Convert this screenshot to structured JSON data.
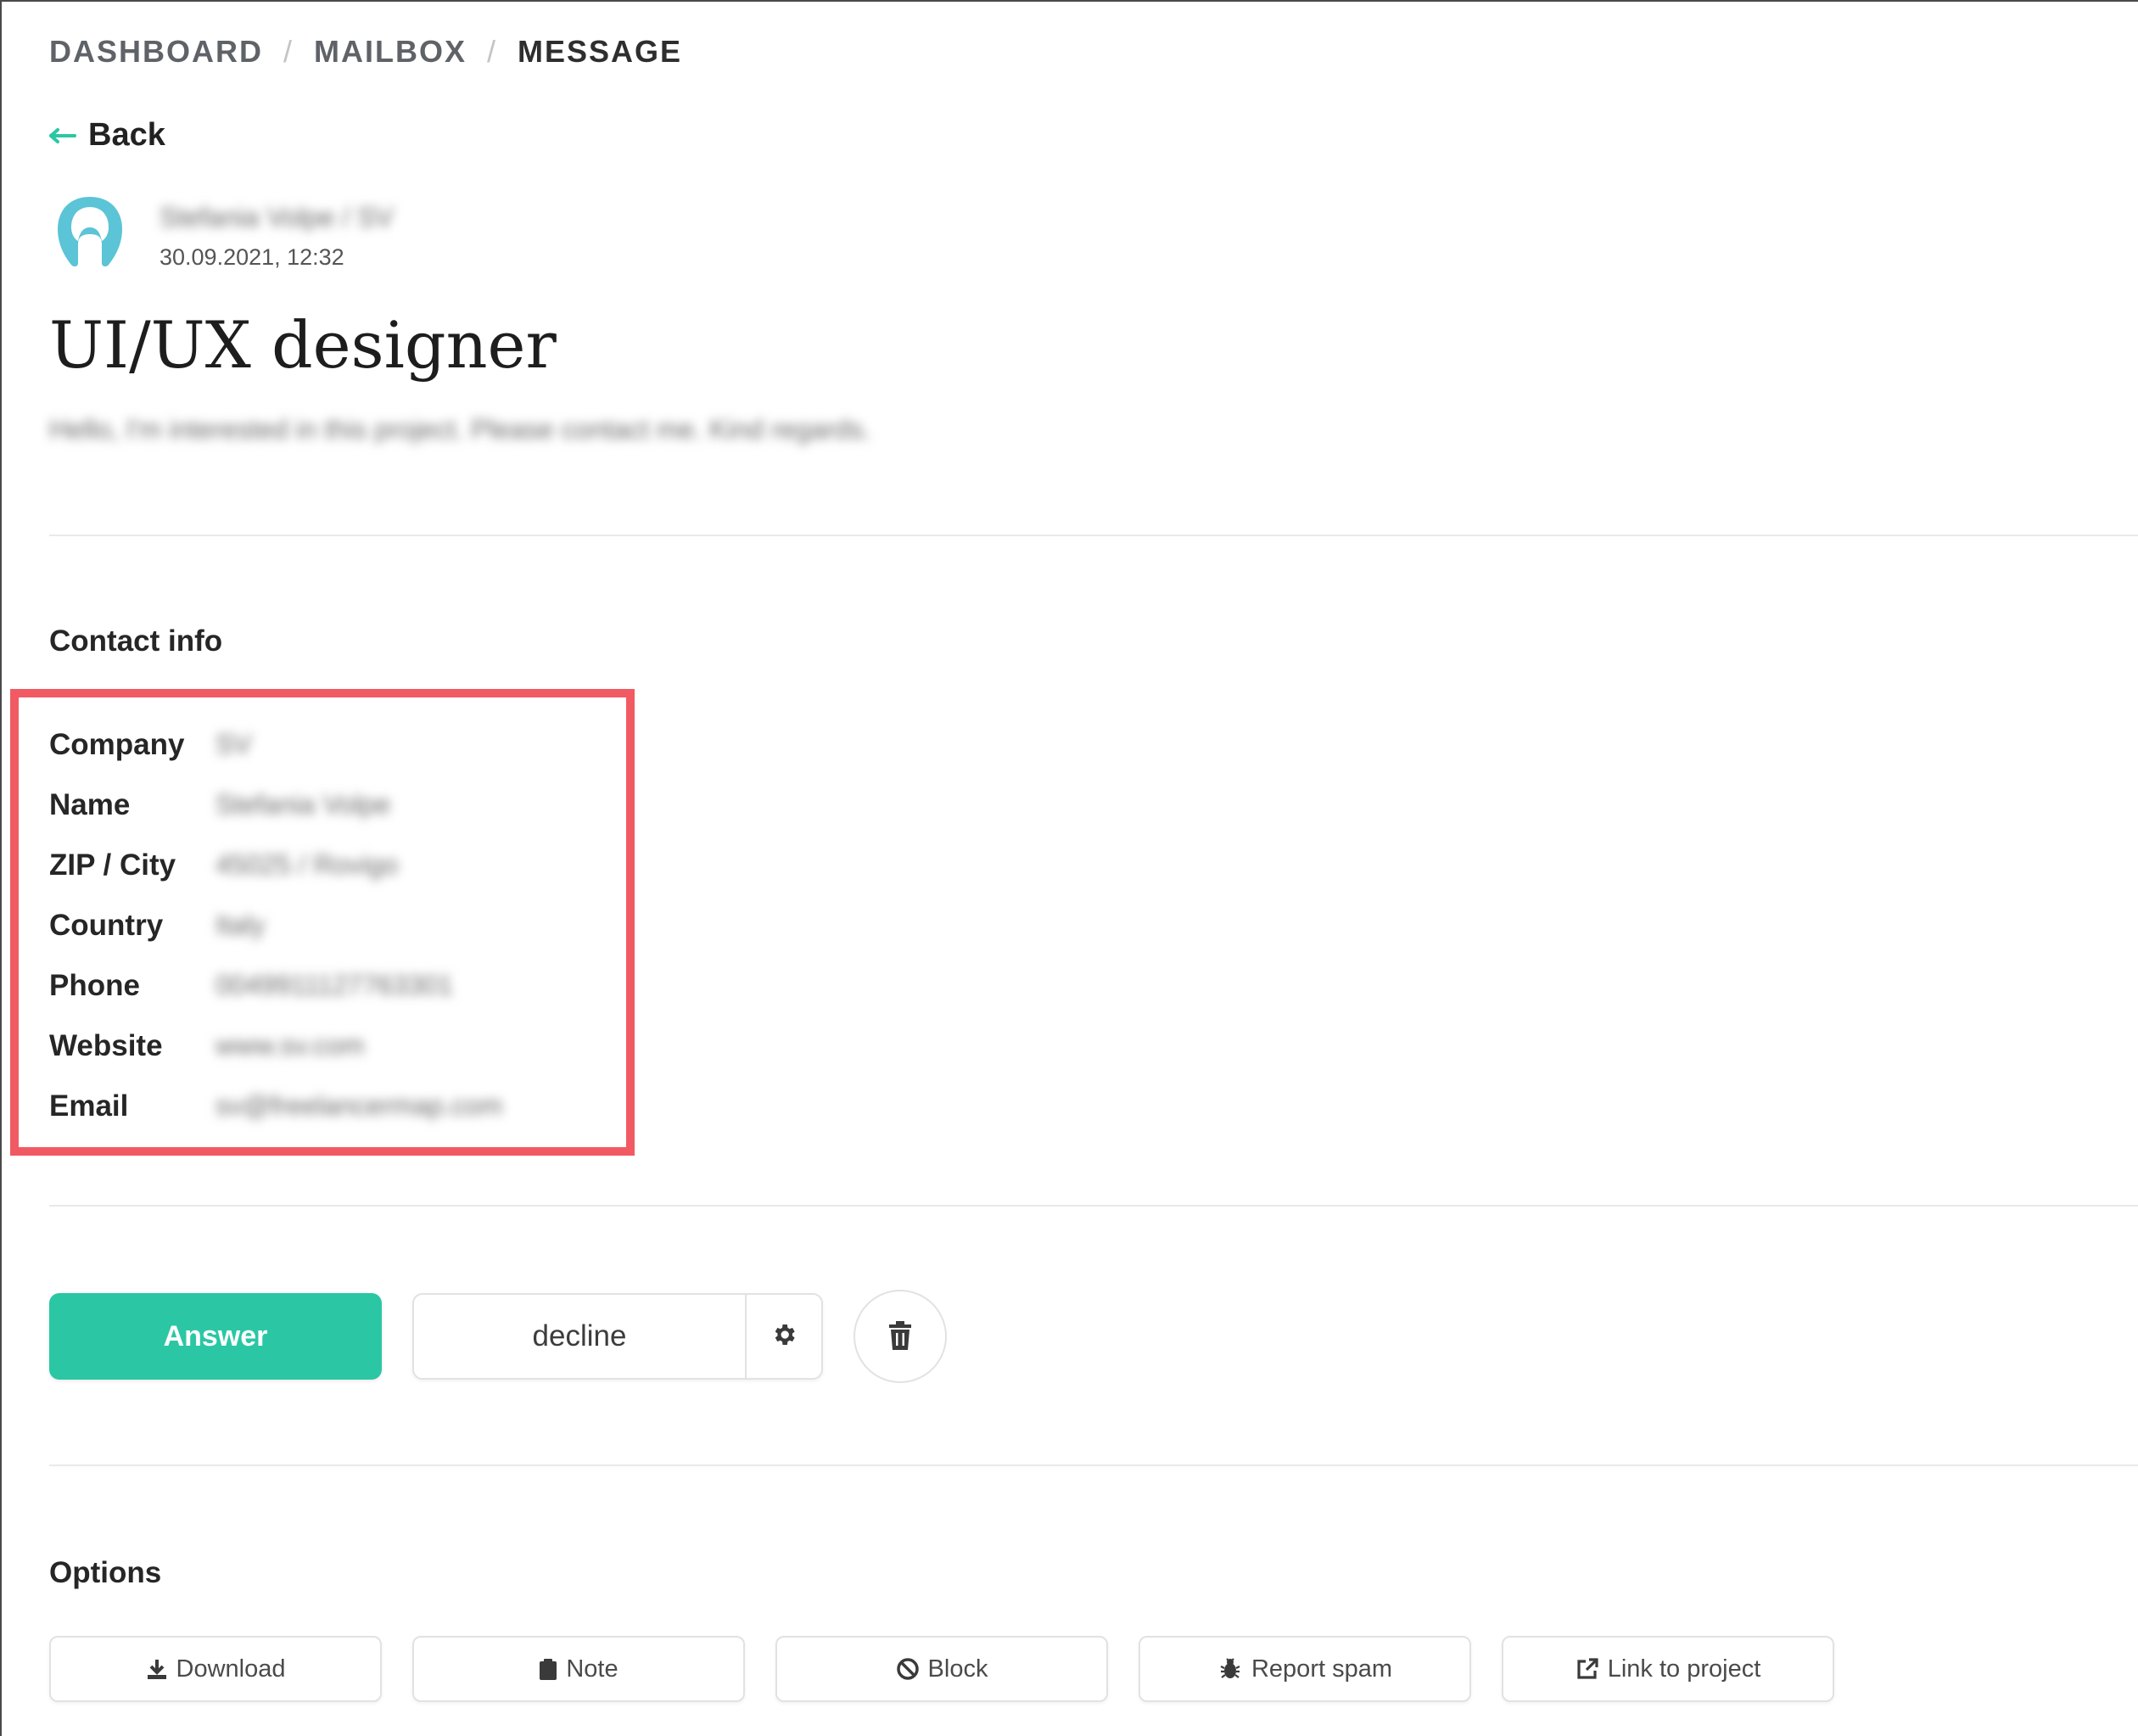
{
  "breadcrumb": {
    "items": [
      "DASHBOARD",
      "MAILBOX",
      "MESSAGE"
    ],
    "separator": "/"
  },
  "back": {
    "label": "Back",
    "icon": "arrow-left-icon"
  },
  "sender": {
    "name": "Stefania Volpe / SV",
    "date": "30.09.2021, 12:32",
    "avatar_icon": "user-avatar-icon"
  },
  "message": {
    "subject": "UI/UX designer",
    "body": "Hello, I'm interested in this project. Please contact me. Kind regards."
  },
  "contact": {
    "title": "Contact info",
    "rows": [
      {
        "label": "Company",
        "value": "SV"
      },
      {
        "label": "Name",
        "value": "Stefania Volpe"
      },
      {
        "label": "ZIP / City",
        "value": "45025 / Rovigo"
      },
      {
        "label": "Country",
        "value": "Italy"
      },
      {
        "label": "Phone",
        "value": "0049911127763301"
      },
      {
        "label": "Website",
        "value": "www.sv.com"
      },
      {
        "label": "Email",
        "value": "sv@freelancermap.com"
      }
    ]
  },
  "actions": {
    "answer": "Answer",
    "decline": "decline",
    "settings_icon": "gear-icon",
    "delete_icon": "trash-icon"
  },
  "options": {
    "title": "Options",
    "buttons": [
      {
        "label": "Download",
        "icon": "download-icon"
      },
      {
        "label": "Note",
        "icon": "clipboard-icon"
      },
      {
        "label": "Block",
        "icon": "block-icon"
      },
      {
        "label": "Report spam",
        "icon": "bug-icon"
      },
      {
        "label": "Link to project",
        "icon": "external-link-icon"
      }
    ]
  },
  "colors": {
    "accent": "#2bc7a4",
    "highlight_border": "#f15a63",
    "avatar": "#5bc4d6"
  }
}
